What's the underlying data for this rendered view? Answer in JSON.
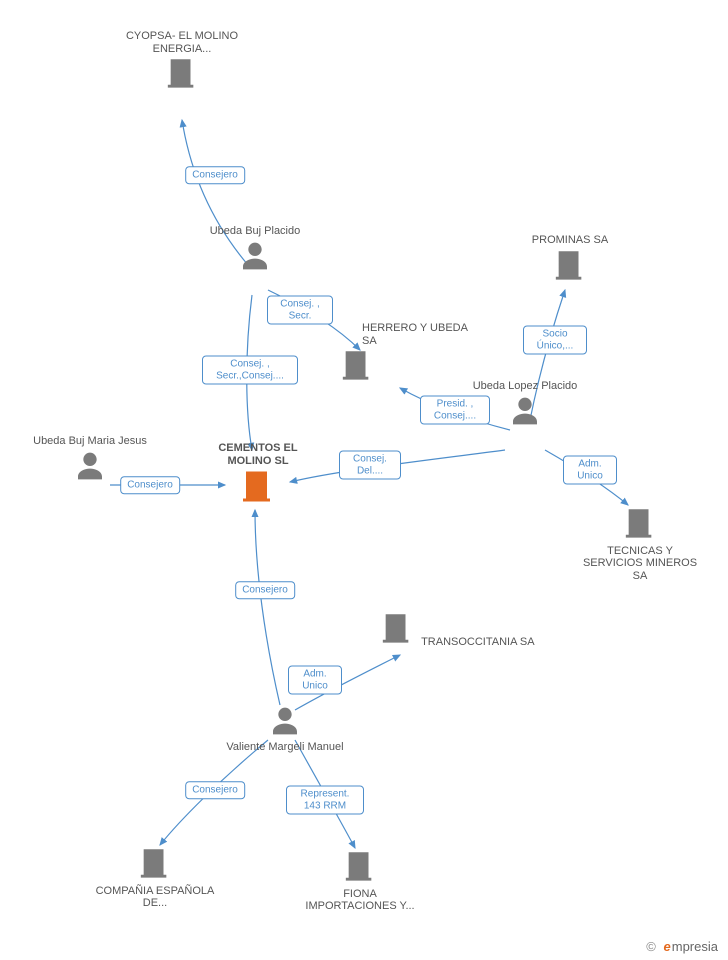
{
  "focal": {
    "label": "CEMENTOS EL MOLINO SL"
  },
  "nodes": {
    "cyopsa": {
      "type": "company",
      "label": "CYOPSA- EL MOLINO ENERGIA..."
    },
    "ubeda_buj_p": {
      "type": "person",
      "label": "Ubeda Buj Placido"
    },
    "herrero": {
      "type": "company",
      "label": "HERRERO Y UBEDA SA"
    },
    "prominas": {
      "type": "company",
      "label": "PROMINAS SA"
    },
    "ubeda_lopez_p": {
      "type": "person",
      "label": "Ubeda Lopez Placido"
    },
    "ubeda_buj_mj": {
      "type": "person",
      "label": "Ubeda Buj Maria Jesus"
    },
    "tecnicas": {
      "type": "company",
      "label": "TECNICAS Y SERVICIOS MINEROS SA"
    },
    "transoc": {
      "type": "company",
      "label": "TRANSOCCITANIA SA"
    },
    "valiente": {
      "type": "person",
      "label": "Valiente Margeli Manuel"
    },
    "compania": {
      "type": "company",
      "label": "COMPAÑIA ESPAÑOLA DE..."
    },
    "fiona": {
      "type": "company",
      "label": "FIONA IMPORTACIONES Y..."
    }
  },
  "edges": {
    "e_consejero_cyopsa": {
      "label": "Consejero"
    },
    "e_consej_secr": {
      "label": "Consej. , Secr."
    },
    "e_consej_secr_consej": {
      "label": "Consej. , Secr.,Consej...."
    },
    "e_socio_unico": {
      "label": "Socio Único,..."
    },
    "e_presid_consej": {
      "label": "Presid. , Consej...."
    },
    "e_consej_del": {
      "label": "Consej. Del...."
    },
    "e_adm_unico_tec": {
      "label": "Adm. Unico"
    },
    "e_consejero_mj": {
      "label": "Consejero"
    },
    "e_consejero_val": {
      "label": "Consejero"
    },
    "e_adm_unico_trans": {
      "label": "Adm. Unico"
    },
    "e_consejero_comp": {
      "label": "Consejero"
    },
    "e_represent": {
      "label": "Represent. 143 RRM"
    }
  },
  "watermark": {
    "copyright": "©",
    "brand_initial": "e",
    "brand_rest": "mpresia"
  },
  "colors": {
    "edge": "#4e8ecb",
    "icon_gray": "#7b7b7b",
    "focal": "#e46a1f"
  }
}
